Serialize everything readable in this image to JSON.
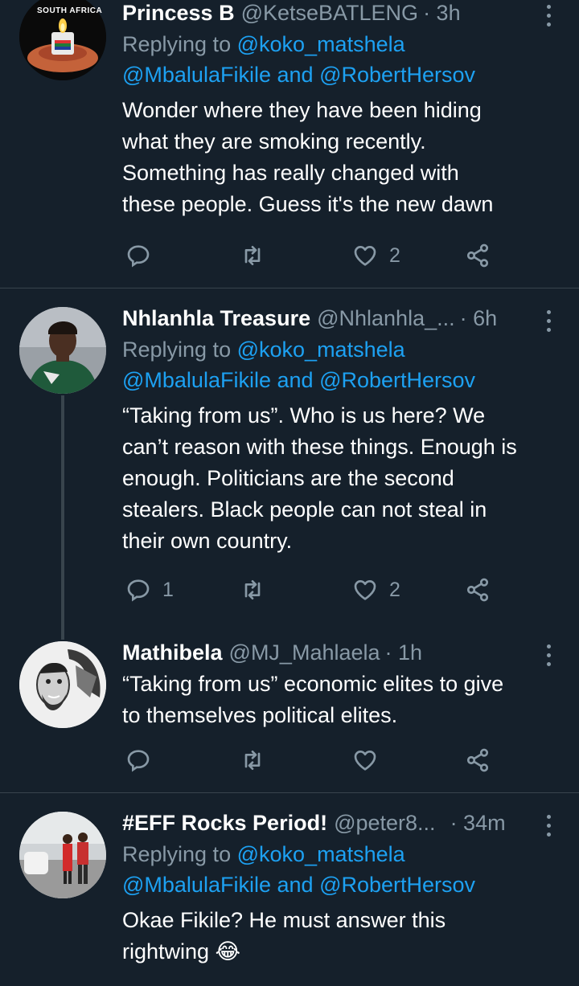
{
  "tweets": [
    {
      "name": "Princess B",
      "handle": "@KetseBATLENG",
      "time": "· 3h",
      "reply_prefix": "Replying to",
      "reply_to_1": "@koko_matshela",
      "reply_to_2": "@MbalulaFikile",
      "reply_and": "and",
      "reply_to_3": "@RobertHersov",
      "avatar_caption": "SOUTH AFRICA",
      "lines": [
        "Wonder where they have been hiding",
        "what they are smoking recently.",
        "Something has really changed with",
        "these people. Guess it's the new dawn"
      ],
      "reply_count": "",
      "retweet_count": "",
      "like_count": "2"
    },
    {
      "name": "Nhlanhla Treasure",
      "handle": "@Nhlanhla_...",
      "time": "· 6h",
      "reply_prefix": "Replying to",
      "reply_to_1": "@koko_matshela",
      "reply_to_2": "@MbalulaFikile",
      "reply_and": "and",
      "reply_to_3": "@RobertHersov",
      "lines": [
        "“Taking from us”. Who is us here? We",
        "can’t reason with these things. Enough is",
        "enough. Politicians are the second",
        "stealers. Black people can not steal in",
        "their own country."
      ],
      "reply_count": "1",
      "retweet_count": "",
      "like_count": "2"
    },
    {
      "name": "Mathibela",
      "handle": "@MJ_Mahlaela",
      "time": "· 1h",
      "lines": [
        "“Taking from us” economic elites to give",
        "to themselves political elites."
      ],
      "reply_count": "",
      "retweet_count": "",
      "like_count": ""
    },
    {
      "name": "#EFF Rocks Period!",
      "handle": "@peter8...",
      "time": "· 34m",
      "reply_prefix": "Replying to",
      "reply_to_1": "@koko_matshela",
      "reply_to_2": "@MbalulaFikile",
      "reply_and": "and",
      "reply_to_3": "@RobertHersov",
      "lines": [
        "Okae Fikile? He must answer this",
        "rightwing 😂"
      ]
    }
  ],
  "icons": [
    "reply-icon",
    "retweet-icon",
    "like-icon",
    "share-icon",
    "more-icon"
  ],
  "colors": {
    "background": "#15202b",
    "secondary_text": "#8899a6",
    "link": "#1da1f2",
    "divider": "#38444d"
  }
}
